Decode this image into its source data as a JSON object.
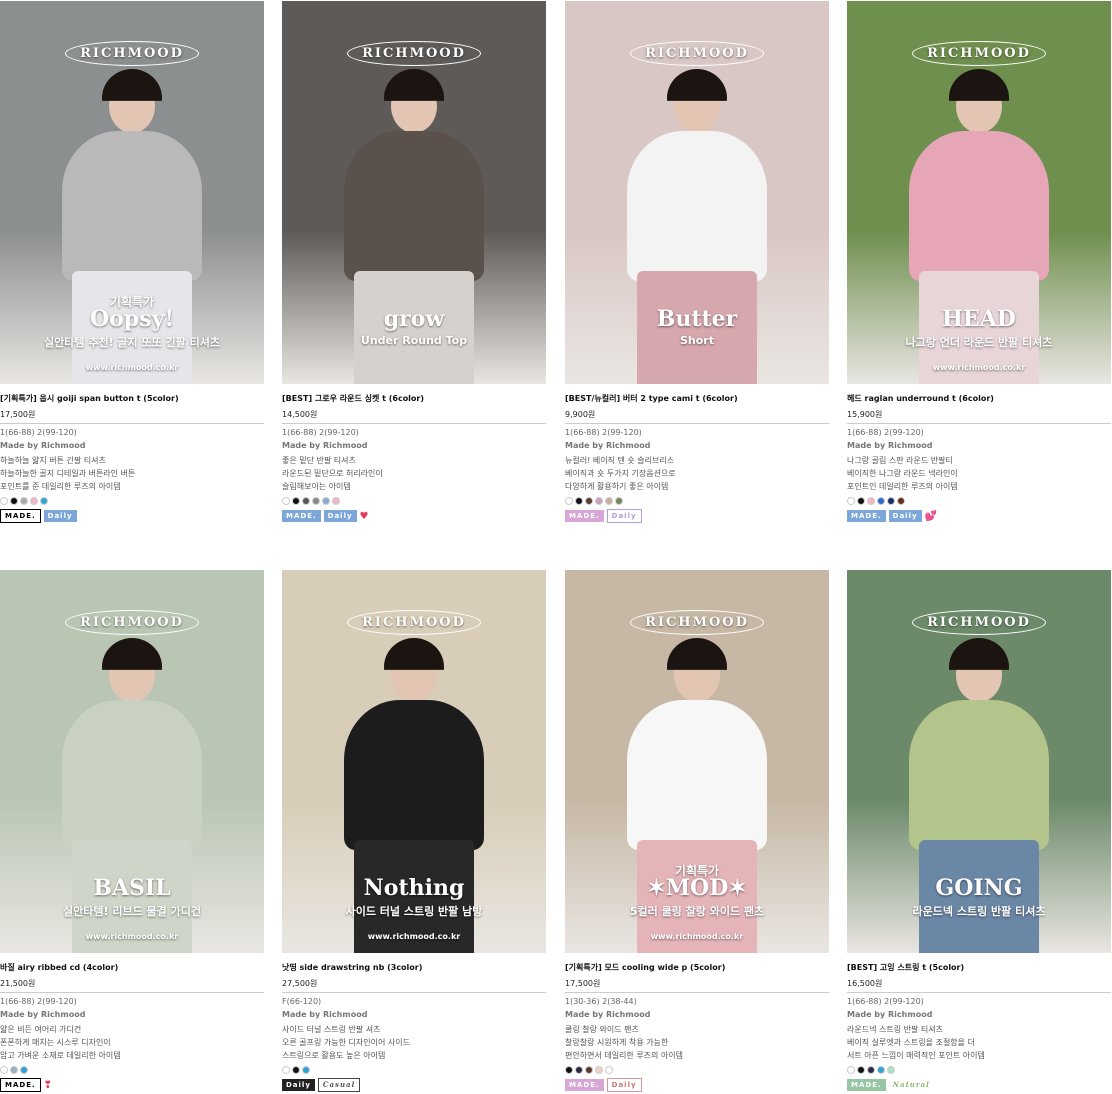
{
  "products": [
    {
      "brand": "RICHMOOD",
      "promo": "기획특가",
      "headline": "Oopsy!",
      "sub": "실안타템 추천! 골지 또또 긴팔 티셔츠",
      "site": "www.richmood.co.kr",
      "title": "[기획특가] 웁시 goiji span button t (5color)",
      "price": "17,500원",
      "size": "1(66-88) 2(99-120)",
      "made": "Made by Richmood",
      "desc": [
        "하늘하늘 얇지 버튼 긴팔 티셔츠",
        "하늘하늘한 골지 디테일과 버튼라인 버튼",
        "포인트를 준 데일리한 루즈의 아이템"
      ],
      "swatches": [
        "#ffffff",
        "#111111",
        "#aaaaaa",
        "#f2b6c8",
        "#2ea3d8"
      ],
      "badges": [
        {
          "text": "MADE.",
          "style": "b-made-w"
        },
        {
          "text": "Daily",
          "style": "b-daily-blue"
        }
      ],
      "heart": ""
    },
    {
      "brand": "RICHMOOD",
      "promo": "",
      "headline": "grow",
      "sub": "Under Round Top",
      "site": "",
      "title": "[BEST] 그로우 라운드 싱켓 t (6color)",
      "price": "14,500원",
      "size": "1(66-88) 2(99-120)",
      "made": "Made by Richmood",
      "desc": [
        "좋은 밑단 반팔 티셔츠",
        "라운드된 밑단으로 허리라인이",
        "슬림해보이는 아이템"
      ],
      "swatches": [
        "#ffffff",
        "#111111",
        "#555555",
        "#888888",
        "#8aa9d6",
        "#f2b6c8"
      ],
      "badges": [
        {
          "text": "MADE.",
          "style": "b-made-blue"
        },
        {
          "text": "Daily",
          "style": "b-daily-blue"
        }
      ],
      "heart": "♥"
    },
    {
      "brand": "RICHMOOD",
      "promo": "",
      "headline": "Butter",
      "sub": "Short",
      "site": "",
      "title": "[BEST/뉴컬러] 버터 2 type cami t (6color)",
      "price": "9,900원",
      "size": "1(66-88) 2(99-120)",
      "made": "Made by Richmood",
      "desc": [
        "뉴컬러! 베이직 텐 숏 슬리브리스",
        "베이직과 숏 두가지 기장옵션으로",
        "다양하게 활용하기 좋은 아이템"
      ],
      "swatches": [
        "#ffffff",
        "#111111",
        "#5a3a2a",
        "#c9a3b8",
        "#c7b299",
        "#6d8a5a"
      ],
      "badges": [
        {
          "text": "MADE.",
          "style": "b-made-pink"
        },
        {
          "text": "Daily",
          "style": "b-daily-purple"
        }
      ],
      "heart": ""
    },
    {
      "brand": "RICHMOOD",
      "promo": "",
      "headline": "HEAD",
      "sub": "나그랑 언더 라운드 반팔 티셔츠",
      "site": "www.richmood.co.kr",
      "title": "헤드 raglan underround t (6color)",
      "price": "15,900원",
      "size": "1(66-88) 2(99-120)",
      "made": "Made by Richmood",
      "desc": [
        "나그랑 골림 스판 라운드 반팔티",
        "베이직한 나그랑 라운드 넥라인이",
        "포인트인 데일리한 루즈의 아이템"
      ],
      "swatches": [
        "#ffffff",
        "#111111",
        "#f2b6c8",
        "#2a6acb",
        "#1a2f6a",
        "#6a2a1a"
      ],
      "badges": [
        {
          "text": "MADE.",
          "style": "b-made-blue"
        },
        {
          "text": "Daily",
          "style": "b-daily-blue"
        }
      ],
      "heart": "💕"
    },
    {
      "brand": "RICHMOOD",
      "promo": "",
      "headline": "BASIL",
      "sub": "실안타템! 리브드 물결 가디건",
      "site": "www.richmood.co.kr",
      "title": "바질 airy ribbed cd (4color)",
      "price": "21,500원",
      "size": "1(66-88) 2(99-120)",
      "made": "Made by Richmood",
      "desc": [
        "얇은 비든 여어리 가디건",
        "폰폰하게 매치는 시스루 디자인이",
        "암고 가벼운 소재로 데일리한 아이템"
      ],
      "swatches": [
        "#ffffff",
        "#9bb0c4",
        "#2ea3d8"
      ],
      "badges": [
        {
          "text": "MADE.",
          "style": "b-made-w"
        }
      ],
      "heart": "❣"
    },
    {
      "brand": "RICHMOOD",
      "promo": "",
      "headline": "Nothing",
      "sub": "사이드 터널 스트링 반팔 남방",
      "site": "www.richmood.co.kr",
      "title": "낫띵 side drawstring nb (3color)",
      "price": "27,500원",
      "size": "F(66-120)",
      "made": "Made by Richmood",
      "desc": [
        "사이드 터널 스트링 반팔 셔츠",
        "오른 골프링 가능한 디자인이어 사이드",
        "스트링으로 활용도 높은 아이템"
      ],
      "swatches": [
        "#ffffff",
        "#111111",
        "#2ea3d8"
      ],
      "badges": [
        {
          "text": "Daily",
          "style": "b-daily-black"
        },
        {
          "text": "Casual",
          "style": "b-casual"
        }
      ],
      "heart": ""
    },
    {
      "brand": "RICHMOOD",
      "promo": "기획특가",
      "headline": "✶MOD✶",
      "sub": "5컬러 쿨링 찰랑 와이드 팬츠",
      "site": "www.richmood.co.kr",
      "title": "[기획특가] 모드 cooling wide p (5color)",
      "price": "17,500원",
      "size": "1(30-36) 2(38-44)",
      "made": "Made by Richmood",
      "desc": [
        "쿨링 찰랑 와이드 팬츠",
        "찰랑찰랑 시원하게 착용 가능한",
        "편안하면서 데일리한 루즈의 아이템"
      ],
      "swatches": [
        "#111111",
        "#2a2a4a",
        "#5a3a2a",
        "#f2d0c8",
        "#ffffff"
      ],
      "badges": [
        {
          "text": "MADE.",
          "style": "b-made-pink"
        },
        {
          "text": "Daily",
          "style": "b-daily-outline"
        }
      ],
      "heart": ""
    },
    {
      "brand": "RICHMOOD",
      "promo": "",
      "headline": "GOING",
      "sub": "라운드넥 스트링 반팔 티셔츠",
      "site": "",
      "title": "[BEST] 고잉 스트링 t (5color)",
      "price": "16,500원",
      "size": "1(66-88) 2(99-120)",
      "made": "Made by Richmood",
      "desc": [
        "라운드넥 스트링 반팔 티셔츠",
        "베이직 실루엣과 스트링을 조절함을 더",
        "서트 아픈 느낌이 매력적인 포인트 아이템"
      ],
      "swatches": [
        "#ffffff",
        "#111111",
        "#2a2a4a",
        "#2ea3d8",
        "#a7e3c8"
      ],
      "badges": [
        {
          "text": "MADE.",
          "style": "b-made-green"
        },
        {
          "text": "Natural",
          "style": "b-natural"
        }
      ],
      "heart": ""
    }
  ],
  "colors": {
    "bg": [
      "#8c8f90",
      "#5e5a57",
      "#d9c7c5",
      "#6e8f4e",
      "#b9c6b4",
      "#d8cdb8",
      "#c7b8a6",
      "#6c8a6a"
    ],
    "top": [
      "#b9b9b9",
      "#5a514c",
      "#f3f3f3",
      "#e7a6b8",
      "#c9d1c2",
      "#1c1c1c",
      "#f7f7f7",
      "#b4c58c"
    ],
    "bottom": [
      "#e6e6ea",
      "#d6d1cc",
      "#d6a7ad",
      "#e8d5d8",
      "#cfd5c8",
      "#282828",
      "#e5b4b9",
      "#6b87a6"
    ]
  }
}
